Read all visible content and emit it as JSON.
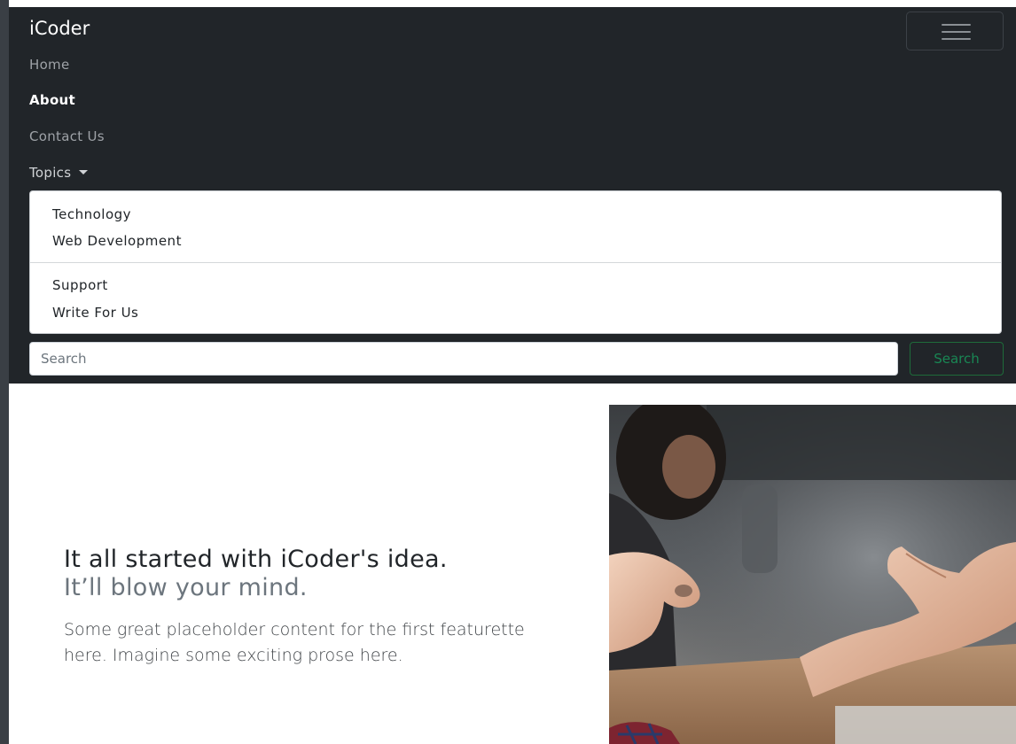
{
  "navbar": {
    "brand": "iCoder",
    "links": [
      {
        "label": "Home",
        "active": false
      },
      {
        "label": "About",
        "active": true
      },
      {
        "label": "Contact Us",
        "active": false
      }
    ],
    "dropdown": {
      "label": "Topics",
      "groups": [
        [
          "Technology",
          "Web Development"
        ],
        [
          "Support",
          "Write For Us"
        ]
      ]
    },
    "search": {
      "placeholder": "Search",
      "button_label": "Search"
    }
  },
  "featurette": {
    "heading": "It all started with iCoder's idea.",
    "heading_muted": "It’ll blow your mind.",
    "lead": "Some great placeholder content for the first featurette here. Imagine some exciting prose here."
  },
  "colors": {
    "navbar_bg": "#212529",
    "search_button": "#198754",
    "text": "#212529",
    "muted": "#6c757d"
  },
  "icons": {
    "toggler": "hamburger-menu-icon",
    "dropdown_caret": "caret-down-icon"
  }
}
